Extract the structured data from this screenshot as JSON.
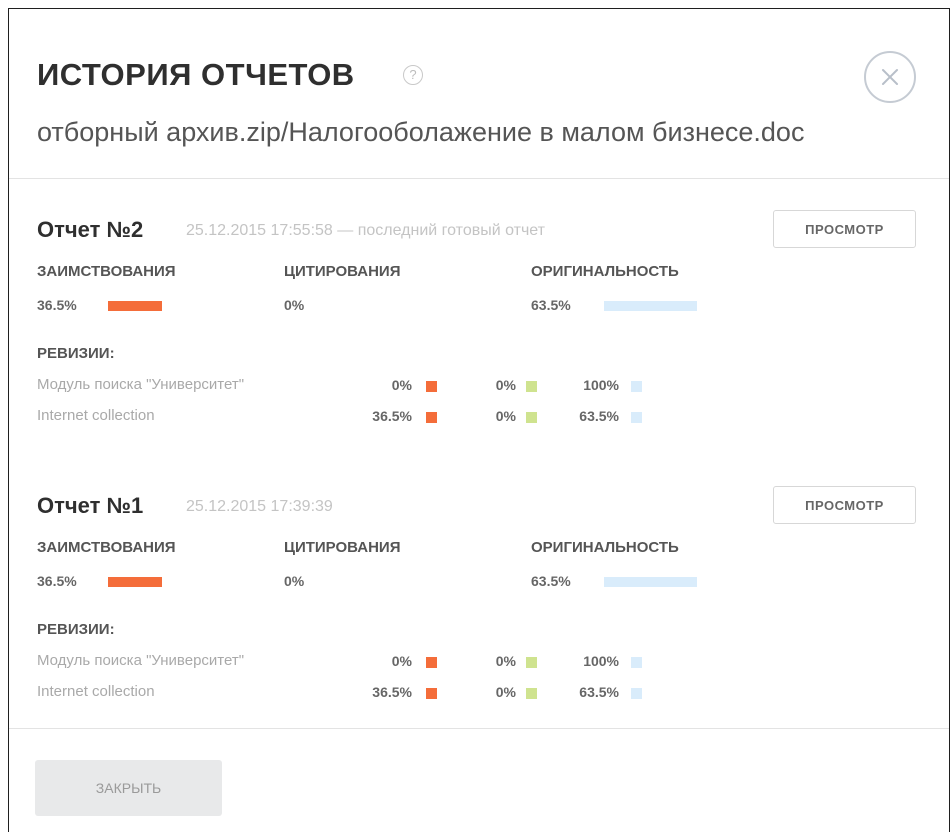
{
  "dialog": {
    "title": "ИСТОРИЯ ОТЧЕТОВ",
    "help_icon": "?",
    "subtitle": "отборный архив.zip/Налогооболажение в малом бизнесе.doc",
    "close_button": "ЗАКРЫТЬ"
  },
  "colors": {
    "borrowing": "#f46d3a",
    "citation": "#cfe38f",
    "originality": "#d9ecfb"
  },
  "reports": [
    {
      "title": "Отчет №2",
      "date": "25.12.2015 17:55:58 — последний готовый отчет",
      "view_button": "ПРОСМОТР",
      "borrowing_label": "ЗАИМСТВОВАНИЯ",
      "borrowing_value": "36.5%",
      "borrowing_fraction": 0.365,
      "citation_label": "ЦИТИРОВАНИЯ",
      "citation_value": "0%",
      "originality_label": "ОРИГИНАЛЬНОСТЬ",
      "originality_value": "63.5%",
      "originality_fraction": 0.635,
      "revisions_label": "РЕВИЗИИ:",
      "revisions": [
        {
          "name": "Модуль поиска \"Университет\"",
          "borrowing": "0%",
          "citation": "0%",
          "originality": "100%"
        },
        {
          "name": "Internet collection",
          "borrowing": "36.5%",
          "citation": "0%",
          "originality": "63.5%"
        }
      ]
    },
    {
      "title": "Отчет №1",
      "date": "25.12.2015 17:39:39",
      "view_button": "ПРОСМОТР",
      "borrowing_label": "ЗАИМСТВОВАНИЯ",
      "borrowing_value": "36.5%",
      "borrowing_fraction": 0.365,
      "citation_label": "ЦИТИРОВАНИЯ",
      "citation_value": "0%",
      "originality_label": "ОРИГИНАЛЬНОСТЬ",
      "originality_value": "63.5%",
      "originality_fraction": 0.635,
      "revisions_label": "РЕВИЗИИ:",
      "revisions": [
        {
          "name": "Модуль поиска \"Университет\"",
          "borrowing": "0%",
          "citation": "0%",
          "originality": "100%"
        },
        {
          "name": "Internet collection",
          "borrowing": "36.5%",
          "citation": "0%",
          "originality": "63.5%"
        }
      ]
    }
  ]
}
